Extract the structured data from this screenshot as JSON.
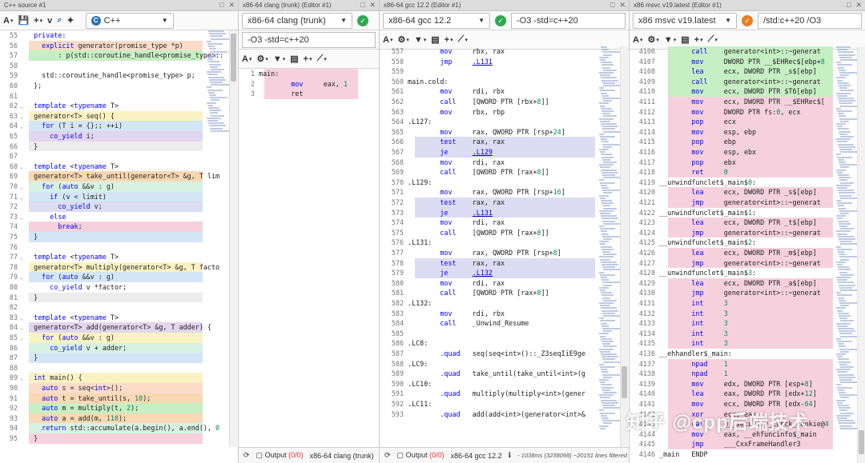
{
  "colors": {
    "green": "#c6efc3",
    "pink": "#f6d1dd",
    "blue": "#d4e6f6",
    "purple": "#e2d6ef",
    "orange": "#f9d8b4",
    "gray": "#ececec",
    "yellow": "#fbf2c4",
    "lavender": "#dcdcf2",
    "mint": "#d7f1e3",
    "peach": "#fadcc9"
  },
  "source": {
    "tab": "C++ source #1",
    "language": "C++",
    "lines": [
      {
        "n": "55",
        "t": "  private:",
        "c": ""
      },
      {
        "n": "56",
        "t": "    explicit generator(promise_type *p)",
        "c": "peach"
      },
      {
        "n": "57",
        "t": "        : p(std::coroutine_handle<promise_type>::",
        "c": "green"
      },
      {
        "n": "58",
        "t": "",
        "c": ""
      },
      {
        "n": "59",
        "t": "    std::coroutine_handle<promise_type> p;",
        "c": ""
      },
      {
        "n": "60",
        "t": "  };",
        "c": ""
      },
      {
        "n": "61",
        "t": "",
        "c": ""
      },
      {
        "n": "62",
        "t": "  template <typename T>",
        "c": ""
      },
      {
        "n": "63",
        "t": "  generator<T> seq() {",
        "c": "yellow"
      },
      {
        "n": "64",
        "t": "    for (T i = {};; ++i)",
        "c": "blue"
      },
      {
        "n": "65",
        "t": "      co_yield i;",
        "c": "purple"
      },
      {
        "n": "66",
        "t": "  }",
        "c": "gray"
      },
      {
        "n": "67",
        "t": "",
        "c": ""
      },
      {
        "n": "68",
        "t": "  template <typename T>",
        "c": ""
      },
      {
        "n": "69",
        "t": "  generator<T> take_until(generator<T> &g, T lim",
        "c": "orange"
      },
      {
        "n": "70",
        "t": "    for (auto &&v : g)",
        "c": "mint"
      },
      {
        "n": "71",
        "t": "      if (v < limit)",
        "c": "blue"
      },
      {
        "n": "72",
        "t": "        co_yield v;",
        "c": "lavender"
      },
      {
        "n": "73",
        "t": "      else",
        "c": ""
      },
      {
        "n": "74",
        "t": "        break;",
        "c": "pink"
      },
      {
        "n": "75",
        "t": "  }",
        "c": "blue"
      },
      {
        "n": "76",
        "t": "",
        "c": ""
      },
      {
        "n": "77",
        "t": "  template <typename T>",
        "c": ""
      },
      {
        "n": "78",
        "t": "  generator<T> multiply(generator<T> &g, T facto",
        "c": "yellow"
      },
      {
        "n": "79",
        "t": "    for (auto &&v : g)",
        "c": "blue"
      },
      {
        "n": "80",
        "t": "      co_yield v *factor;",
        "c": ""
      },
      {
        "n": "81",
        "t": "  }",
        "c": "gray"
      },
      {
        "n": "82",
        "t": "",
        "c": ""
      },
      {
        "n": "83",
        "t": "  template <typename T>",
        "c": ""
      },
      {
        "n": "84",
        "t": "  generator<T> add(generator<T> &g, T adder) {",
        "c": "purple"
      },
      {
        "n": "85",
        "t": "    for (auto &&v : g)",
        "c": "yellow"
      },
      {
        "n": "86",
        "t": "      co_yield v + adder;",
        "c": "mint"
      },
      {
        "n": "87",
        "t": "  }",
        "c": "blue"
      },
      {
        "n": "88",
        "t": "",
        "c": ""
      },
      {
        "n": "89",
        "t": "  int main() {",
        "c": "yellow"
      },
      {
        "n": "90",
        "t": "    auto s = seq<int>();",
        "c": "peach"
      },
      {
        "n": "91",
        "t": "    auto t = take_until(s, 10);",
        "c": "orange"
      },
      {
        "n": "92",
        "t": "    auto m = multiply(t, 2);",
        "c": "green"
      },
      {
        "n": "93",
        "t": "    auto a = add(m, 110);",
        "c": "orange"
      },
      {
        "n": "94",
        "t": "    return std::accumulate(a.begin(), a.end(), 0",
        "c": "mint"
      },
      {
        "n": "95",
        "t": "  }",
        "c": "pink"
      }
    ]
  },
  "clang": {
    "tab": "x86-64 clang (trunk) (Editor #1)",
    "compiler": "x86-64 clang (trunk)",
    "flags": "-O3 -std=c++20",
    "lines": [
      {
        "n": "1",
        "t": "main:",
        "c": "pink"
      },
      {
        "n": "2",
        "t": "        mov     eax, 1",
        "c": "pink"
      },
      {
        "n": "3",
        "t": "        ret",
        "c": "pink"
      }
    ],
    "output_label": "Output",
    "output_count": "(0/0)",
    "footer": "x86-64 clang (trunk)"
  },
  "gcc": {
    "tab": "x86-64 gcc 12.2 (Editor #1)",
    "compiler": "x86-64 gcc 12.2",
    "flags": "-O3 -std=c++20",
    "lines": [
      {
        "n": "557",
        "t": "        mov     rbx, rax",
        "c": ""
      },
      {
        "n": "558",
        "t": "        jmp     .L131",
        "c": ""
      },
      {
        "n": "559",
        "t": "",
        "c": ""
      },
      {
        "n": "560",
        "t": "main.cold:",
        "c": ""
      },
      {
        "n": "561",
        "t": "        mov     rdi, rbx",
        "c": ""
      },
      {
        "n": "562",
        "t": "        call    [QWORD PTR [rbx+8]]",
        "c": ""
      },
      {
        "n": "563",
        "t": "        mov     rbx, rbp",
        "c": ""
      },
      {
        "n": "564",
        "t": ".L127:",
        "c": ""
      },
      {
        "n": "565",
        "t": "        mov     rax, QWORD PTR [rsp+24]",
        "c": ""
      },
      {
        "n": "566",
        "t": "        test    rax, rax",
        "c": "lavender"
      },
      {
        "n": "567",
        "t": "        je      .L129",
        "c": "lavender"
      },
      {
        "n": "568",
        "t": "        mov     rdi, rax",
        "c": ""
      },
      {
        "n": "569",
        "t": "        call    [QWORD PTR [rax+8]]",
        "c": ""
      },
      {
        "n": "570",
        "t": ".L129:",
        "c": ""
      },
      {
        "n": "571",
        "t": "        mov     rax, QWORD PTR [rsp+16]",
        "c": ""
      },
      {
        "n": "572",
        "t": "        test    rax, rax",
        "c": "lavender"
      },
      {
        "n": "573",
        "t": "        je      .L131",
        "c": "lavender"
      },
      {
        "n": "574",
        "t": "        mov     rdi, rax",
        "c": ""
      },
      {
        "n": "575",
        "t": "        call    [QWORD PTR [rax+8]]",
        "c": ""
      },
      {
        "n": "576",
        "t": ".L131:",
        "c": ""
      },
      {
        "n": "577",
        "t": "        mov     rax, QWORD PTR [rsp+8]",
        "c": ""
      },
      {
        "n": "578",
        "t": "        test    rax, rax",
        "c": "lavender"
      },
      {
        "n": "579",
        "t": "        je      .L132",
        "c": "lavender"
      },
      {
        "n": "580",
        "t": "        mov     rdi, rax",
        "c": ""
      },
      {
        "n": "581",
        "t": "        call    [QWORD PTR [rax+8]]",
        "c": ""
      },
      {
        "n": "582",
        "t": ".L132:",
        "c": ""
      },
      {
        "n": "583",
        "t": "        mov     rdi, rbx",
        "c": ""
      },
      {
        "n": "584",
        "t": "        call    _Unwind_Resume",
        "c": ""
      },
      {
        "n": "585",
        "t": "",
        "c": ""
      },
      {
        "n": "586",
        "t": ".LC8:",
        "c": ""
      },
      {
        "n": "587",
        "t": "        .quad   seq(seq<int>()::_Z3seqIiE9ge",
        "c": ""
      },
      {
        "n": "588",
        "t": ".LC9:",
        "c": ""
      },
      {
        "n": "589",
        "t": "        .quad   take_until(take_until<int>(g",
        "c": ""
      },
      {
        "n": "590",
        "t": ".LC10:",
        "c": ""
      },
      {
        "n": "591",
        "t": "        .quad   multiply(multiply<int>(gener",
        "c": ""
      },
      {
        "n": "592",
        "t": ".LC11:",
        "c": ""
      },
      {
        "n": "593",
        "t": "        .quad   add(add<int>(generator<int>&",
        "c": ""
      }
    ],
    "output_label": "Output",
    "output_count": "(0/0)",
    "footer": "x86-64 gcc 12.2",
    "info": "- 1038ms (3238098) ~20151 lines filtered"
  },
  "msvc": {
    "tab": "x86 msvc v19.latest (Editor #1)",
    "compiler": "x86 msvc v19.latest",
    "flags": "/std:c++20 /O3",
    "lines": [
      {
        "n": "4106",
        "t": "        call    generator<int>::~generat",
        "c": "green"
      },
      {
        "n": "4107",
        "t": "        mov     DWORD PTR __$EHRec$[ebp+8",
        "c": "green"
      },
      {
        "n": "4108",
        "t": "        lea     ecx, DWORD PTR _s$[ebp]",
        "c": "green"
      },
      {
        "n": "4109",
        "t": "        call    generator<int>::~generat",
        "c": "green"
      },
      {
        "n": "4110",
        "t": "        mov     ecx, DWORD PTR $T6[ebp]",
        "c": "green"
      },
      {
        "n": "4111",
        "t": "        mov     ecx, DWORD PTR __$EHRec$[",
        "c": "pink"
      },
      {
        "n": "4112",
        "t": "        mov     DWORD PTR fs:0, ecx",
        "c": "pink"
      },
      {
        "n": "4113",
        "t": "        pop     ecx",
        "c": "pink"
      },
      {
        "n": "4114",
        "t": "        mov     esp, ebp",
        "c": "pink"
      },
      {
        "n": "4115",
        "t": "        pop     ebp",
        "c": "pink"
      },
      {
        "n": "4116",
        "t": "        mov     esp, ebx",
        "c": "pink"
      },
      {
        "n": "4117",
        "t": "        pop     ebx",
        "c": "pink"
      },
      {
        "n": "4118",
        "t": "        ret     0",
        "c": "pink"
      },
      {
        "n": "4119",
        "t": "__unwindfunclet$_main$0:",
        "c": ""
      },
      {
        "n": "4120",
        "t": "        lea     ecx, DWORD PTR _s$[ebp]",
        "c": "pink"
      },
      {
        "n": "4121",
        "t": "        jmp     generator<int>::~generat",
        "c": "pink"
      },
      {
        "n": "4122",
        "t": "__unwindfunclet$_main$1:",
        "c": ""
      },
      {
        "n": "4123",
        "t": "        lea     ecx, DWORD PTR _t$[ebp]",
        "c": "pink"
      },
      {
        "n": "4124",
        "t": "        jmp     generator<int>::~generat",
        "c": "pink"
      },
      {
        "n": "4125",
        "t": "__unwindfunclet$_main$2:",
        "c": ""
      },
      {
        "n": "4126",
        "t": "        lea     ecx, DWORD PTR _m$[ebp]",
        "c": "pink"
      },
      {
        "n": "4127",
        "t": "        jmp     generator<int>::~generat",
        "c": "pink"
      },
      {
        "n": "4128",
        "t": "__unwindfunclet$_main$3:",
        "c": ""
      },
      {
        "n": "4129",
        "t": "        lea     ecx, DWORD PTR _a$[ebp]",
        "c": "pink"
      },
      {
        "n": "4130",
        "t": "        jmp     generator<int>::~generat",
        "c": "pink"
      },
      {
        "n": "4131",
        "t": "        int     3",
        "c": "pink"
      },
      {
        "n": "4132",
        "t": "        int     3",
        "c": "pink"
      },
      {
        "n": "4133",
        "t": "        int     3",
        "c": "pink"
      },
      {
        "n": "4134",
        "t": "        int     3",
        "c": "pink"
      },
      {
        "n": "4135",
        "t": "        int     3",
        "c": "pink"
      },
      {
        "n": "4136",
        "t": "__ehhandler$_main:",
        "c": ""
      },
      {
        "n": "4137",
        "t": "        npad    1",
        "c": "pink"
      },
      {
        "n": "4138",
        "t": "        npad    1",
        "c": "pink"
      },
      {
        "n": "4139",
        "t": "        mov     edx, DWORD PTR [esp+8]",
        "c": "pink"
      },
      {
        "n": "4140",
        "t": "        lea     eax, DWORD PTR [edx+12]",
        "c": "pink"
      },
      {
        "n": "4141",
        "t": "        mov     ecx, DWORD PTR [edx-64]",
        "c": "pink"
      },
      {
        "n": "4142",
        "t": "        xor     ecx, eax",
        "c": "pink"
      },
      {
        "n": "4143",
        "t": "        call    @__security_check_cookie@4",
        "c": "pink"
      },
      {
        "n": "4144",
        "t": "        mov     eax, __ehfuncinfo$_main",
        "c": "pink"
      },
      {
        "n": "4145",
        "t": "        jmp     ___CxxFrameHandler3",
        "c": "pink"
      },
      {
        "n": "4146",
        "t": "_main   ENDP",
        "c": ""
      }
    ]
  },
  "watermark": "知乎 @cpp后端技术"
}
